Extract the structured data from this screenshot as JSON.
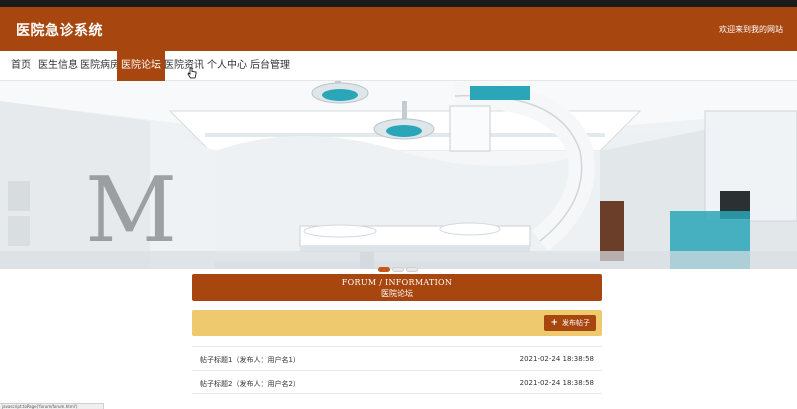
{
  "header": {
    "brand": "医院急诊系统",
    "welcome": "欢迎来到我的网站"
  },
  "nav": {
    "items": [
      {
        "label": "首页"
      },
      {
        "label": "医生信息"
      },
      {
        "label": "医院病房"
      },
      {
        "label": "医院论坛",
        "active": true
      },
      {
        "label": "医院资讯"
      },
      {
        "label": "个人中心"
      },
      {
        "label": "后台管理"
      }
    ]
  },
  "banner": {
    "slides": 3,
    "active_slide": 1
  },
  "forum": {
    "title_en": "FORUM / INFORMATION",
    "title_cn": "医院论坛",
    "post_button": "发布帖子"
  },
  "posts": [
    {
      "title": "帖子标题1（发布人：用户名1）",
      "date": "2021-02-24 18:38:58"
    },
    {
      "title": "帖子标题2（发布人：用户名2）",
      "date": "2021-02-24 18:38:58"
    }
  ],
  "statusbar": {
    "text": "javascript:toPage('forum/forum.html')"
  },
  "colors": {
    "brand": "#a8460f",
    "accent_bar": "#efc96e",
    "teal": "#2aa6b8"
  }
}
